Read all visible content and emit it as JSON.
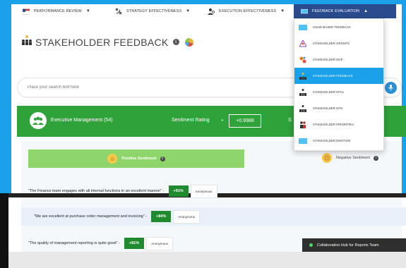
{
  "nav": {
    "items": [
      {
        "label": "PERFORMANCE REVIEW",
        "icon": "flag-icon"
      },
      {
        "label": "STRATEGY EFFECTIVENESS",
        "icon": "strategy-icon"
      },
      {
        "label": "EXECUTION EFFECTIVENESS",
        "icon": "person-gear-icon"
      },
      {
        "label": "FEEDBACK EVALUATION",
        "icon": "monitor-icon"
      }
    ]
  },
  "page": {
    "title": "STAKEHOLDER FEEDBACK",
    "info": "i"
  },
  "search": {
    "placeholder": "Place your search text here"
  },
  "exec": {
    "name": "Executive Management (54)",
    "sentiment_label": "Sentiment Rating",
    "sentiment_value": "+0.9988",
    "clipped": "S"
  },
  "tabs": {
    "positive": "Positive Sentiment",
    "negative": "Negative Sentiment"
  },
  "feedback": [
    {
      "text": "\"The Finance team engages with all internal functions in an excellent manner\" -",
      "pct": "+91%",
      "author": "Anonymous"
    },
    {
      "text": "\"We are excellent at purchase order management and invoicing\" -",
      "pct": "+84%",
      "author": "Anonymous"
    },
    {
      "text": "\"The quality of management reporting is quite good\" -",
      "pct": "+81%",
      "author": "Anonymous"
    }
  ],
  "hub": {
    "label": "Collaboration Hub for Reports Team"
  },
  "dropdown": {
    "items": [
      {
        "label": "ISSUE-BASED FEEDBACK",
        "icon": "issue-card-icon"
      },
      {
        "label": "STAKEHOLDER GROUPS",
        "icon": "groups-icon"
      },
      {
        "label": "STAKEHOLDER MAP",
        "icon": "map-icon"
      },
      {
        "label": "STAKEHOLDER FEEDBACK",
        "icon": "hierarchy-icon",
        "active": true
      },
      {
        "label": "STAKEHOLDER KPAs",
        "icon": "kpa-icon"
      },
      {
        "label": "STAKEHOLDER KPIs",
        "icon": "kpi-icon"
      },
      {
        "label": "STAKEHOLDER PRIORITIES",
        "icon": "priorities-icon"
      },
      {
        "label": "STAKEHOLDER EMOTION",
        "icon": "emotion-card-icon"
      }
    ]
  },
  "colors": {
    "brand_blue": "#1ba1ea",
    "nav_active": "#2a4b8d",
    "green": "#2ea33a",
    "positive_tab": "#8ed66c"
  }
}
